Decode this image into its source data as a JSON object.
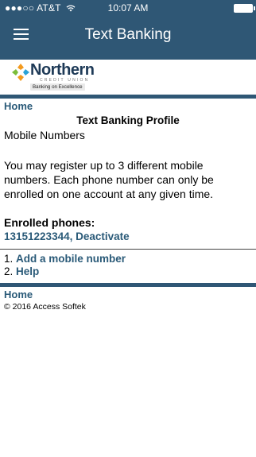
{
  "status_bar": {
    "carrier": "●●●○○ AT&T",
    "wifi_icon": "wifi-icon",
    "time": "10:07 AM",
    "battery_icon": "battery-icon"
  },
  "app_bar": {
    "menu_icon": "hamburger-menu-icon",
    "title": "Text Banking"
  },
  "logo": {
    "name": "Northern",
    "sub": "CREDIT UNION",
    "tagline": "Banking on Excellence"
  },
  "nav": {
    "home_top": "Home"
  },
  "profile": {
    "title": "Text Banking Profile",
    "subtitle": "Mobile Numbers",
    "description": "You may register up to 3 different mobile numbers. Each phone number can only be enrolled on one account at any given time.",
    "enrolled_heading": "Enrolled phones:",
    "enrolled_phone": "13151223344",
    "phone_separator": ", ",
    "deactivate_label": "Deactivate"
  },
  "menu": [
    {
      "number": "1.",
      "label": "Add a mobile number"
    },
    {
      "number": "2.",
      "label": "Help"
    }
  ],
  "footer": {
    "home": "Home",
    "copyright": "© 2016 Access Softek"
  },
  "colors": {
    "brand": "#2f5775",
    "link": "#2a5a78"
  }
}
